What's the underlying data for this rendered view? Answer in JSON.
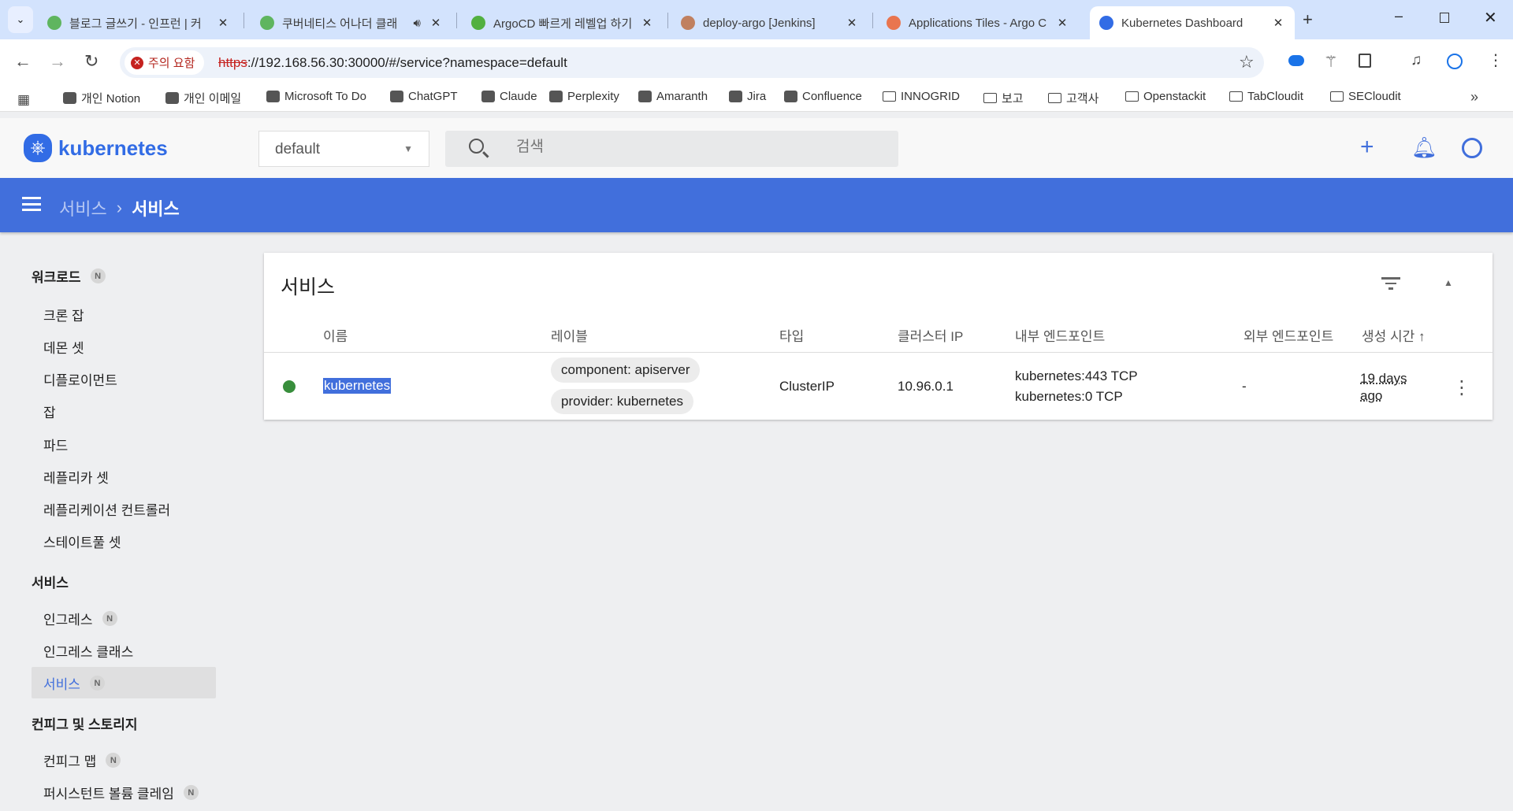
{
  "browser": {
    "tabs": [
      {
        "title": "블로그 글쓰기 - 인프런 | 커",
        "icon": "inflearn-icon",
        "color": "#5fb55f"
      },
      {
        "title": "쿠버네티스 어나더 클래",
        "icon": "inflearn-icon",
        "color": "#5fb55f",
        "audio": true
      },
      {
        "title": "ArgoCD 빠르게 레벨업 하기",
        "icon": "apple-icon",
        "color": "#52b040"
      },
      {
        "title": "deploy-argo [Jenkins]",
        "icon": "jenkins-icon",
        "color": "#c08060"
      },
      {
        "title": "Applications Tiles - Argo CD",
        "icon": "argo-icon",
        "color": "#e9754f"
      },
      {
        "title": "Kubernetes Dashboard",
        "icon": "kubernetes-icon",
        "color": "#326ce5",
        "active": true
      }
    ],
    "security_label": "주의 요함",
    "url_scheme": "https",
    "url_rest": "://192.168.56.30:30000/#/service?namespace=default",
    "bookmarks": [
      "개인 Notion",
      "개인 이메일",
      "Microsoft To Do",
      "ChatGPT",
      "Claude",
      "Perplexity",
      "Amaranth",
      "Jira",
      "Confluence",
      "INNOGRID",
      "보고",
      "고객사",
      "Openstackit",
      "TabCloudit",
      "SECloudit"
    ]
  },
  "app": {
    "logo": "kubernetes",
    "namespace": "default",
    "search_placeholder": "검색",
    "accent": "#416fdc",
    "breadcrumb": [
      "서비스",
      "서비스"
    ]
  },
  "sidebar": {
    "groups": [
      {
        "title": "워크로드",
        "badge": "N",
        "items": [
          {
            "label": "크론 잡"
          },
          {
            "label": "데몬 셋"
          },
          {
            "label": "디플로이먼트"
          },
          {
            "label": "잡"
          },
          {
            "label": "파드"
          },
          {
            "label": "레플리카 셋"
          },
          {
            "label": "레플리케이션 컨트롤러"
          },
          {
            "label": "스테이트풀 셋"
          }
        ]
      },
      {
        "title": "서비스",
        "items": [
          {
            "label": "인그레스",
            "badge": "N"
          },
          {
            "label": "인그레스 클래스"
          },
          {
            "label": "서비스",
            "badge": "N",
            "active": true
          }
        ]
      },
      {
        "title": "컨피그 및 스토리지",
        "items": [
          {
            "label": "컨피그 맵",
            "badge": "N"
          },
          {
            "label": "퍼시스턴트 볼륨 클레임",
            "badge": "N"
          }
        ]
      }
    ]
  },
  "card": {
    "title": "서비스",
    "columns": [
      "이름",
      "레이블",
      "타입",
      "클러스터 IP",
      "내부 엔드포인트",
      "외부 엔드포인트",
      "생성 시간"
    ],
    "rows": [
      {
        "status": "running",
        "status_color": "#388e3c",
        "name": "kubernetes",
        "labels": [
          "component: apiserver",
          "provider: kubernetes"
        ],
        "type": "ClusterIP",
        "cluster_ip": "10.96.0.1",
        "internal_endpoints": [
          "kubernetes:443 TCP",
          "kubernetes:0 TCP"
        ],
        "external_endpoints": "-",
        "age": "19 days ago"
      }
    ]
  }
}
